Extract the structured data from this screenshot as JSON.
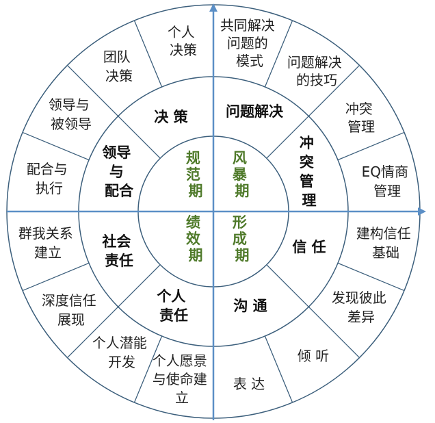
{
  "colors": {
    "stroke": "#3c5f7c",
    "axis": "#5b8fc6",
    "inner_text": "#4f7a2a",
    "ring_text": "#111111",
    "outer_text": "#222222"
  },
  "inner": [
    {
      "label": "规范期"
    },
    {
      "label": "风暴期"
    },
    {
      "label": "形成期"
    },
    {
      "label": "绩效期"
    }
  ],
  "middle": [
    {
      "label": "决 策"
    },
    {
      "label": "问题解决"
    },
    {
      "label": "冲突管理"
    },
    {
      "label": "信 任"
    },
    {
      "label": "沟 通"
    },
    {
      "label": "个人责任"
    },
    {
      "label": "社会责任"
    },
    {
      "label": "领导与配合"
    }
  ],
  "outer": [
    {
      "label": "个人决策"
    },
    {
      "label": "共同解决问题的模式"
    },
    {
      "label": "问题解决的技巧"
    },
    {
      "label": "冲突管理"
    },
    {
      "label": "EQ情商管理"
    },
    {
      "label": "建构信任基础"
    },
    {
      "label": "发现彼此差异"
    },
    {
      "label": "倾 听"
    },
    {
      "label": "表 达"
    },
    {
      "label": "个人愿景与使命建立"
    },
    {
      "label": "个人潜能开发"
    },
    {
      "label": "深度信任展现"
    },
    {
      "label": "群我关系建立"
    },
    {
      "label": "配合与执行"
    },
    {
      "label": "领导与被领导"
    },
    {
      "label": "团队决策"
    }
  ]
}
